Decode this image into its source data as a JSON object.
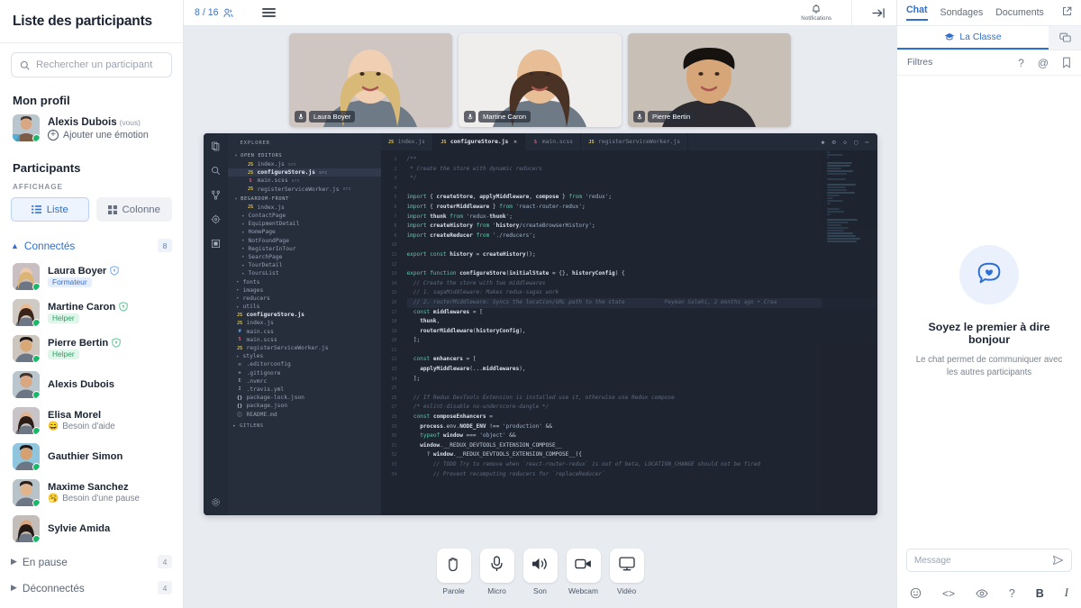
{
  "sidebar": {
    "title": "Liste des participants",
    "search_placeholder": "Rechercher un participant",
    "my_profile_heading": "Mon profil",
    "me": {
      "name": "Alexis Dubois",
      "you_tag": "(vous)",
      "add_emotion": "Ajouter une émotion"
    },
    "participants_heading": "Participants",
    "display_label": "AFFICHAGE",
    "view_list": "Liste",
    "view_column": "Colonne",
    "groups": [
      {
        "name": "Connectés",
        "count": "8",
        "expanded": true
      },
      {
        "name": "En pause",
        "count": "4",
        "expanded": false
      },
      {
        "name": "Déconnectés",
        "count": "4",
        "expanded": false
      }
    ],
    "connected": [
      {
        "name": "Laura Boyer",
        "tag": "Formateur",
        "tag_kind": "formateur",
        "verified": true,
        "status": ""
      },
      {
        "name": "Martine Caron",
        "tag": "Helper",
        "tag_kind": "helper",
        "verified": true,
        "status": ""
      },
      {
        "name": "Pierre Bertin",
        "tag": "Helper",
        "tag_kind": "helper",
        "verified": true,
        "status": ""
      },
      {
        "name": "Alexis Dubois",
        "tag": "",
        "tag_kind": "",
        "verified": false,
        "status": ""
      },
      {
        "name": "Elisa Morel",
        "tag": "",
        "tag_kind": "",
        "verified": false,
        "status": "Besoin d'aide",
        "emoji": "😄"
      },
      {
        "name": "Gauthier Simon",
        "tag": "",
        "tag_kind": "",
        "verified": false,
        "status": ""
      },
      {
        "name": "Maxime Sanchez",
        "tag": "",
        "tag_kind": "",
        "verified": false,
        "status": "Besoin d'une pause",
        "emoji": "🥱"
      },
      {
        "name": "Sylvie Amida",
        "tag": "",
        "tag_kind": "",
        "verified": false,
        "status": ""
      }
    ]
  },
  "topbar": {
    "participant_counter": "8 / 16",
    "notifications_label": "Notifications"
  },
  "stage": {
    "videos": [
      {
        "name": "Laura Boyer"
      },
      {
        "name": "Martine Caron"
      },
      {
        "name": "Pierre Bertin"
      }
    ]
  },
  "editor": {
    "explorer_title": "EXPLORER",
    "open_editors_label": "OPEN EDITORS",
    "project_label": "BEGARDOM-FRONT",
    "gitlens_label": "GITLENS",
    "open_editors": [
      {
        "icon": "JS",
        "kind": "js",
        "name": "index.js",
        "sub": "src",
        "selected": false
      },
      {
        "icon": "JS",
        "kind": "js",
        "name": "configureStore.js",
        "sub": "src",
        "selected": true
      },
      {
        "icon": "S",
        "kind": "scss",
        "name": "main.scss",
        "sub": "src",
        "selected": false
      },
      {
        "icon": "JS",
        "kind": "js",
        "name": "registerServiceWorker.js",
        "sub": "src",
        "selected": false
      }
    ],
    "tree": [
      {
        "icon": "JS",
        "kind": "js",
        "name": "index.js",
        "indent": 2,
        "folder": false
      },
      {
        "icon": "",
        "kind": "gen",
        "name": "ContactPage",
        "indent": 1,
        "folder": true
      },
      {
        "icon": "",
        "kind": "gen",
        "name": "EquipmentDetail",
        "indent": 1,
        "folder": true
      },
      {
        "icon": "",
        "kind": "gen",
        "name": "HomePage",
        "indent": 1,
        "folder": true
      },
      {
        "icon": "",
        "kind": "gen",
        "name": "NotFoundPage",
        "indent": 1,
        "folder": true
      },
      {
        "icon": "",
        "kind": "gen",
        "name": "RegisterInTour",
        "indent": 1,
        "folder": true
      },
      {
        "icon": "",
        "kind": "gen",
        "name": "SearchPage",
        "indent": 1,
        "folder": true
      },
      {
        "icon": "",
        "kind": "gen",
        "name": "TourDetail",
        "indent": 1,
        "folder": true
      },
      {
        "icon": "",
        "kind": "gen",
        "name": "ToursList",
        "indent": 1,
        "folder": true
      },
      {
        "icon": "",
        "kind": "gen",
        "name": "fonts",
        "indent": 0,
        "folder": true
      },
      {
        "icon": "",
        "kind": "gen",
        "name": "images",
        "indent": 0,
        "folder": true
      },
      {
        "icon": "",
        "kind": "gen",
        "name": "reducers",
        "indent": 0,
        "folder": true
      },
      {
        "icon": "",
        "kind": "gen",
        "name": "utils",
        "indent": 0,
        "folder": true
      },
      {
        "icon": "JS",
        "kind": "js",
        "name": "configureStore.js",
        "indent": 0,
        "folder": false,
        "current": true
      },
      {
        "icon": "JS",
        "kind": "js",
        "name": "index.js",
        "indent": 0,
        "folder": false
      },
      {
        "icon": "#",
        "kind": "css",
        "name": "main.css",
        "indent": 0,
        "folder": false
      },
      {
        "icon": "S",
        "kind": "scss",
        "name": "main.scss",
        "indent": 0,
        "folder": false
      },
      {
        "icon": "JS",
        "kind": "js",
        "name": "registerServiceWorker.js",
        "indent": 0,
        "folder": false
      },
      {
        "icon": "",
        "kind": "gen",
        "name": "styles",
        "indent": 0,
        "folder": true
      },
      {
        "icon": "⚙",
        "kind": "gen",
        "name": ".editorconfig",
        "indent": 0,
        "folder": false
      },
      {
        "icon": "◈",
        "kind": "gen",
        "name": ".gitignore",
        "indent": 0,
        "folder": false
      },
      {
        "icon": "E",
        "kind": "gen",
        "name": ".nvmrc",
        "indent": 0,
        "folder": false
      },
      {
        "icon": "I",
        "kind": "gen",
        "name": ".travis.yml",
        "indent": 0,
        "folder": false
      },
      {
        "icon": "{}",
        "kind": "json",
        "name": "package-lock.json",
        "indent": 0,
        "folder": false
      },
      {
        "icon": "{}",
        "kind": "json",
        "name": "package.json",
        "indent": 0,
        "folder": false
      },
      {
        "icon": "ⓘ",
        "kind": "md",
        "name": "README.md",
        "indent": 0,
        "folder": false
      }
    ],
    "tabs": [
      {
        "icon": "JS",
        "kind": "js",
        "name": "index.js",
        "active": false,
        "closable": false
      },
      {
        "icon": "JS",
        "kind": "js",
        "name": "configureStore.js",
        "active": true,
        "closable": true
      },
      {
        "icon": "S",
        "kind": "scss",
        "name": "main.scss",
        "active": false,
        "closable": false
      },
      {
        "icon": "JS",
        "kind": "js",
        "name": "registerServiceWorker.js",
        "active": false,
        "closable": false
      }
    ],
    "blame_annotation": "Peyman Salehi, 2 months ago • Crea",
    "first_line": 1,
    "last_line": 34,
    "code_lines": [
      "/**",
      " * Create the store with dynamic reducers",
      " */",
      "",
      "import { createStore, applyMiddleware, compose } from 'redux';",
      "import { routerMiddleware } from 'react-router-redux';",
      "import thunk from 'redux-thunk';",
      "import createHistory from 'history/createBrowserHistory';",
      "import createReducer from './reducers';",
      "",
      "export const history = createHistory();",
      "",
      "export function configureStore(initialState = {}, historyConfig) {",
      "  // Create the store with two middlewares",
      "  // 1. sagaMiddleware: Makes redux-sagas work",
      "  // 2. routerMiddleware: Syncs the location/URL path to the state",
      "  const middlewares = [",
      "    thunk,",
      "    routerMiddleware(historyConfig),",
      "  ];",
      "",
      "  const enhancers = [",
      "    applyMiddleware(...middlewares),",
      "  ];",
      "",
      "  // If Redux DevTools Extension is installed use it, otherwise use Redux compose",
      "  /* eslint-disable no-underscore-dangle */",
      "  const composeEnhancers =",
      "    process.env.NODE_ENV !== 'production' &&",
      "    typeof window === 'object' &&",
      "    window.__REDUX_DEVTOOLS_EXTENSION_COMPOSE__",
      "      ? window.__REDUX_DEVTOOLS_EXTENSION_COMPOSE__({",
      "        // TODO Try to remove when `react-router-redux` is out of beta, LOCATION_CHANGE should not be fired",
      "        // Prevent recomputing reducers for `replaceReducer`"
    ]
  },
  "controls": [
    {
      "label": "Parole",
      "icon": "hand-icon"
    },
    {
      "label": "Micro",
      "icon": "microphone-icon"
    },
    {
      "label": "Son",
      "icon": "speaker-icon"
    },
    {
      "label": "Webcam",
      "icon": "video-camera-icon"
    },
    {
      "label": "Vidéo",
      "icon": "monitor-icon"
    }
  ],
  "right_panel": {
    "tabs": [
      {
        "label": "Chat",
        "active": true
      },
      {
        "label": "Sondages",
        "active": false
      },
      {
        "label": "Documents",
        "active": false
      }
    ],
    "channel": "La Classe",
    "filters_label": "Filtres",
    "empty_title": "Soyez le premier à dire bonjour",
    "empty_text": "Le chat permet de communiquer avec les autres participants",
    "message_placeholder": "Message",
    "format_icons": [
      "emoji-icon",
      "code-icon",
      "eye-icon",
      "question-icon",
      "bold-icon",
      "italic-icon"
    ]
  },
  "colors": {
    "accent": "#2f6fd0",
    "online": "#19b869",
    "bg": "#e8ebf0",
    "panel": "#ffffff",
    "editor_bg": "#1e2430"
  }
}
